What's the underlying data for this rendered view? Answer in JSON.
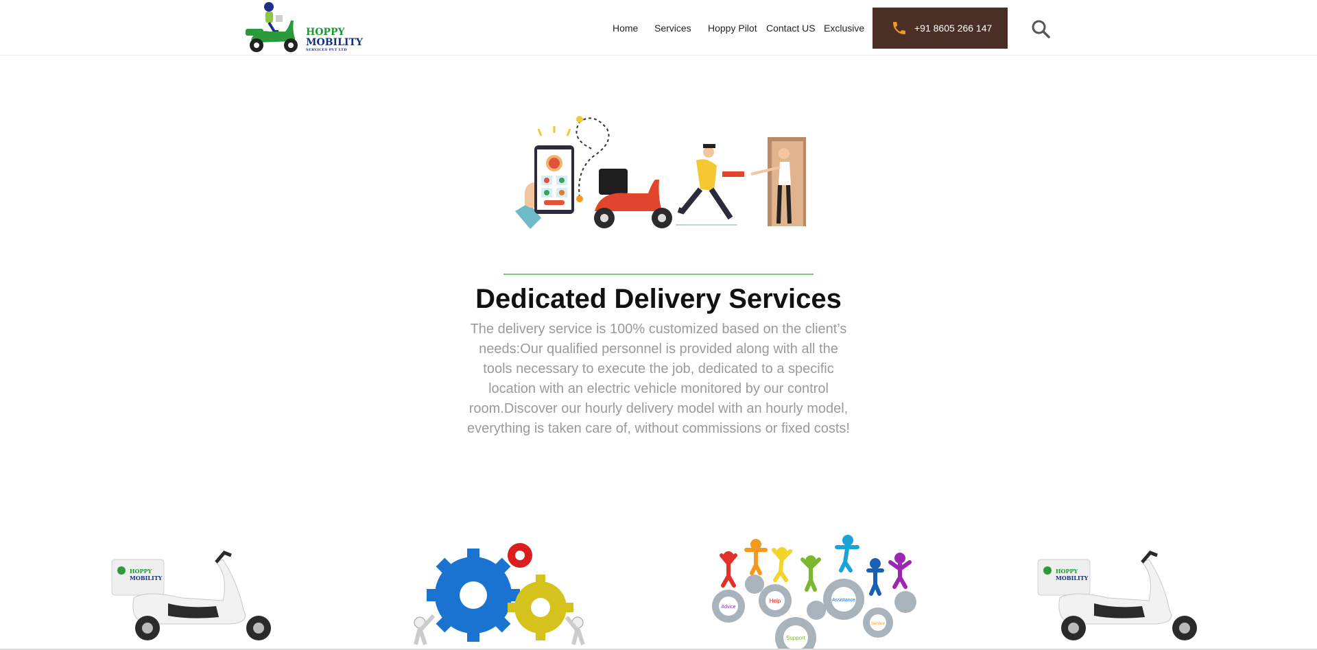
{
  "header": {
    "logo": {
      "line1": "HOPPY",
      "line2": "MOBILITY",
      "line3": "SERVICES PVT LTD"
    },
    "nav": [
      {
        "label": "Home"
      },
      {
        "label": "Services"
      },
      {
        "label": "Hoppy Pilot"
      },
      {
        "label": "Contact US"
      },
      {
        "label": "Exclusive"
      }
    ],
    "phone": {
      "label": "+91 8605 266 147",
      "icon": "phone-icon"
    },
    "search": {
      "icon": "search-icon"
    }
  },
  "hero": {
    "title": "Dedicated Delivery Services",
    "description": "The delivery service is 100% customized based on the client’s needs:Our qualified personnel is provided along with all the tools necessary to execute the job, dedicated to a specific location with an electric vehicle monitored by our control room.Discover our hourly delivery model with an hourly model, everything is taken care of, without commissions or fixed costs!"
  },
  "gallery": {
    "gears_labels": [
      "Advice",
      "Help",
      "Assistance",
      "Support",
      "Service"
    ],
    "scooter_box_line1": "HOPPY",
    "scooter_box_line2": "MOBILITY"
  },
  "colors": {
    "accent_button": "#4a2f27",
    "divider": "#7cc97b",
    "phone_icon": "#f39a1e"
  }
}
